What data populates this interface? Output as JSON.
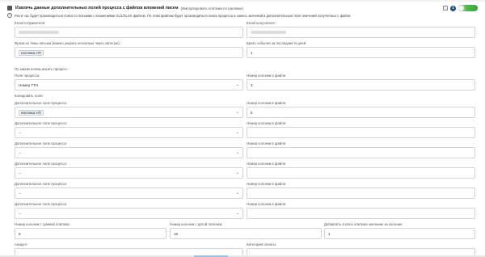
{
  "header": {
    "title": "Извлечь данные дополнительных полей процесса с файлов вложений писем",
    "subtitle": "(Импортировать платежи по наложке)",
    "info_icon": "info-icon",
    "toggle_color": "#3aa53a"
  },
  "note": "Раз в час будет производиться поиск по письмам с вложениями XLS/XLSX файлов. По этим файлам будет производиться поиск процесса и запись значений в дополнительные поля значений полученных с файла",
  "email_from": {
    "label": "Email отправителя:"
  },
  "email_to": {
    "label": "Email получателя:"
  },
  "subject": {
    "label": "Фраза из темы письма (можно указать несколько через запятую):",
    "value": "наложка НП"
  },
  "days": {
    "label": "Брать события за последние N дней:",
    "value": "1"
  },
  "search_section": "По каким полям искать процесс:",
  "process_field": {
    "label": "Поле процесса:",
    "value": "Номер ТТН"
  },
  "process_col": {
    "label": "Номер колонки в файле:",
    "value": "3"
  },
  "copy_section": "Копировать поля:",
  "extra_rows": [
    {
      "label": "Дополнительное поле процесса:",
      "value": "наложка НП",
      "col_label": "Номер колонки в файле:",
      "col_value": "5"
    },
    {
      "label": "Дополнительное поле процесса:",
      "value": "--",
      "col_label": "Номер колонки в файле:",
      "col_value": ""
    },
    {
      "label": "Дополнительное поле процесса:",
      "value": "--",
      "col_label": "Номер колонки в файле:",
      "col_value": ""
    },
    {
      "label": "Дополнительное поле процесса:",
      "value": "--",
      "col_label": "Номер колонки в файле:",
      "col_value": ""
    },
    {
      "label": "Дополнительное поле процесса:",
      "value": "--",
      "col_label": "Номер колонки в файле:",
      "col_value": ""
    },
    {
      "label": "Дополнительное поле процесса:",
      "value": "--",
      "col_label": "Номер колонки в файле:",
      "col_value": ""
    }
  ],
  "sum_col": {
    "label": "Номер колонки с суммой платежа:",
    "value": "5"
  },
  "date_col": {
    "label": "Номер колонки с датой платежа:",
    "value": "16"
  },
  "key_col": {
    "label": "Добавлять в ключ платежа значение из колонки:",
    "value": "1"
  },
  "account": {
    "label": "Аккаунт:"
  },
  "category": {
    "label": "Категория оплаты:"
  }
}
